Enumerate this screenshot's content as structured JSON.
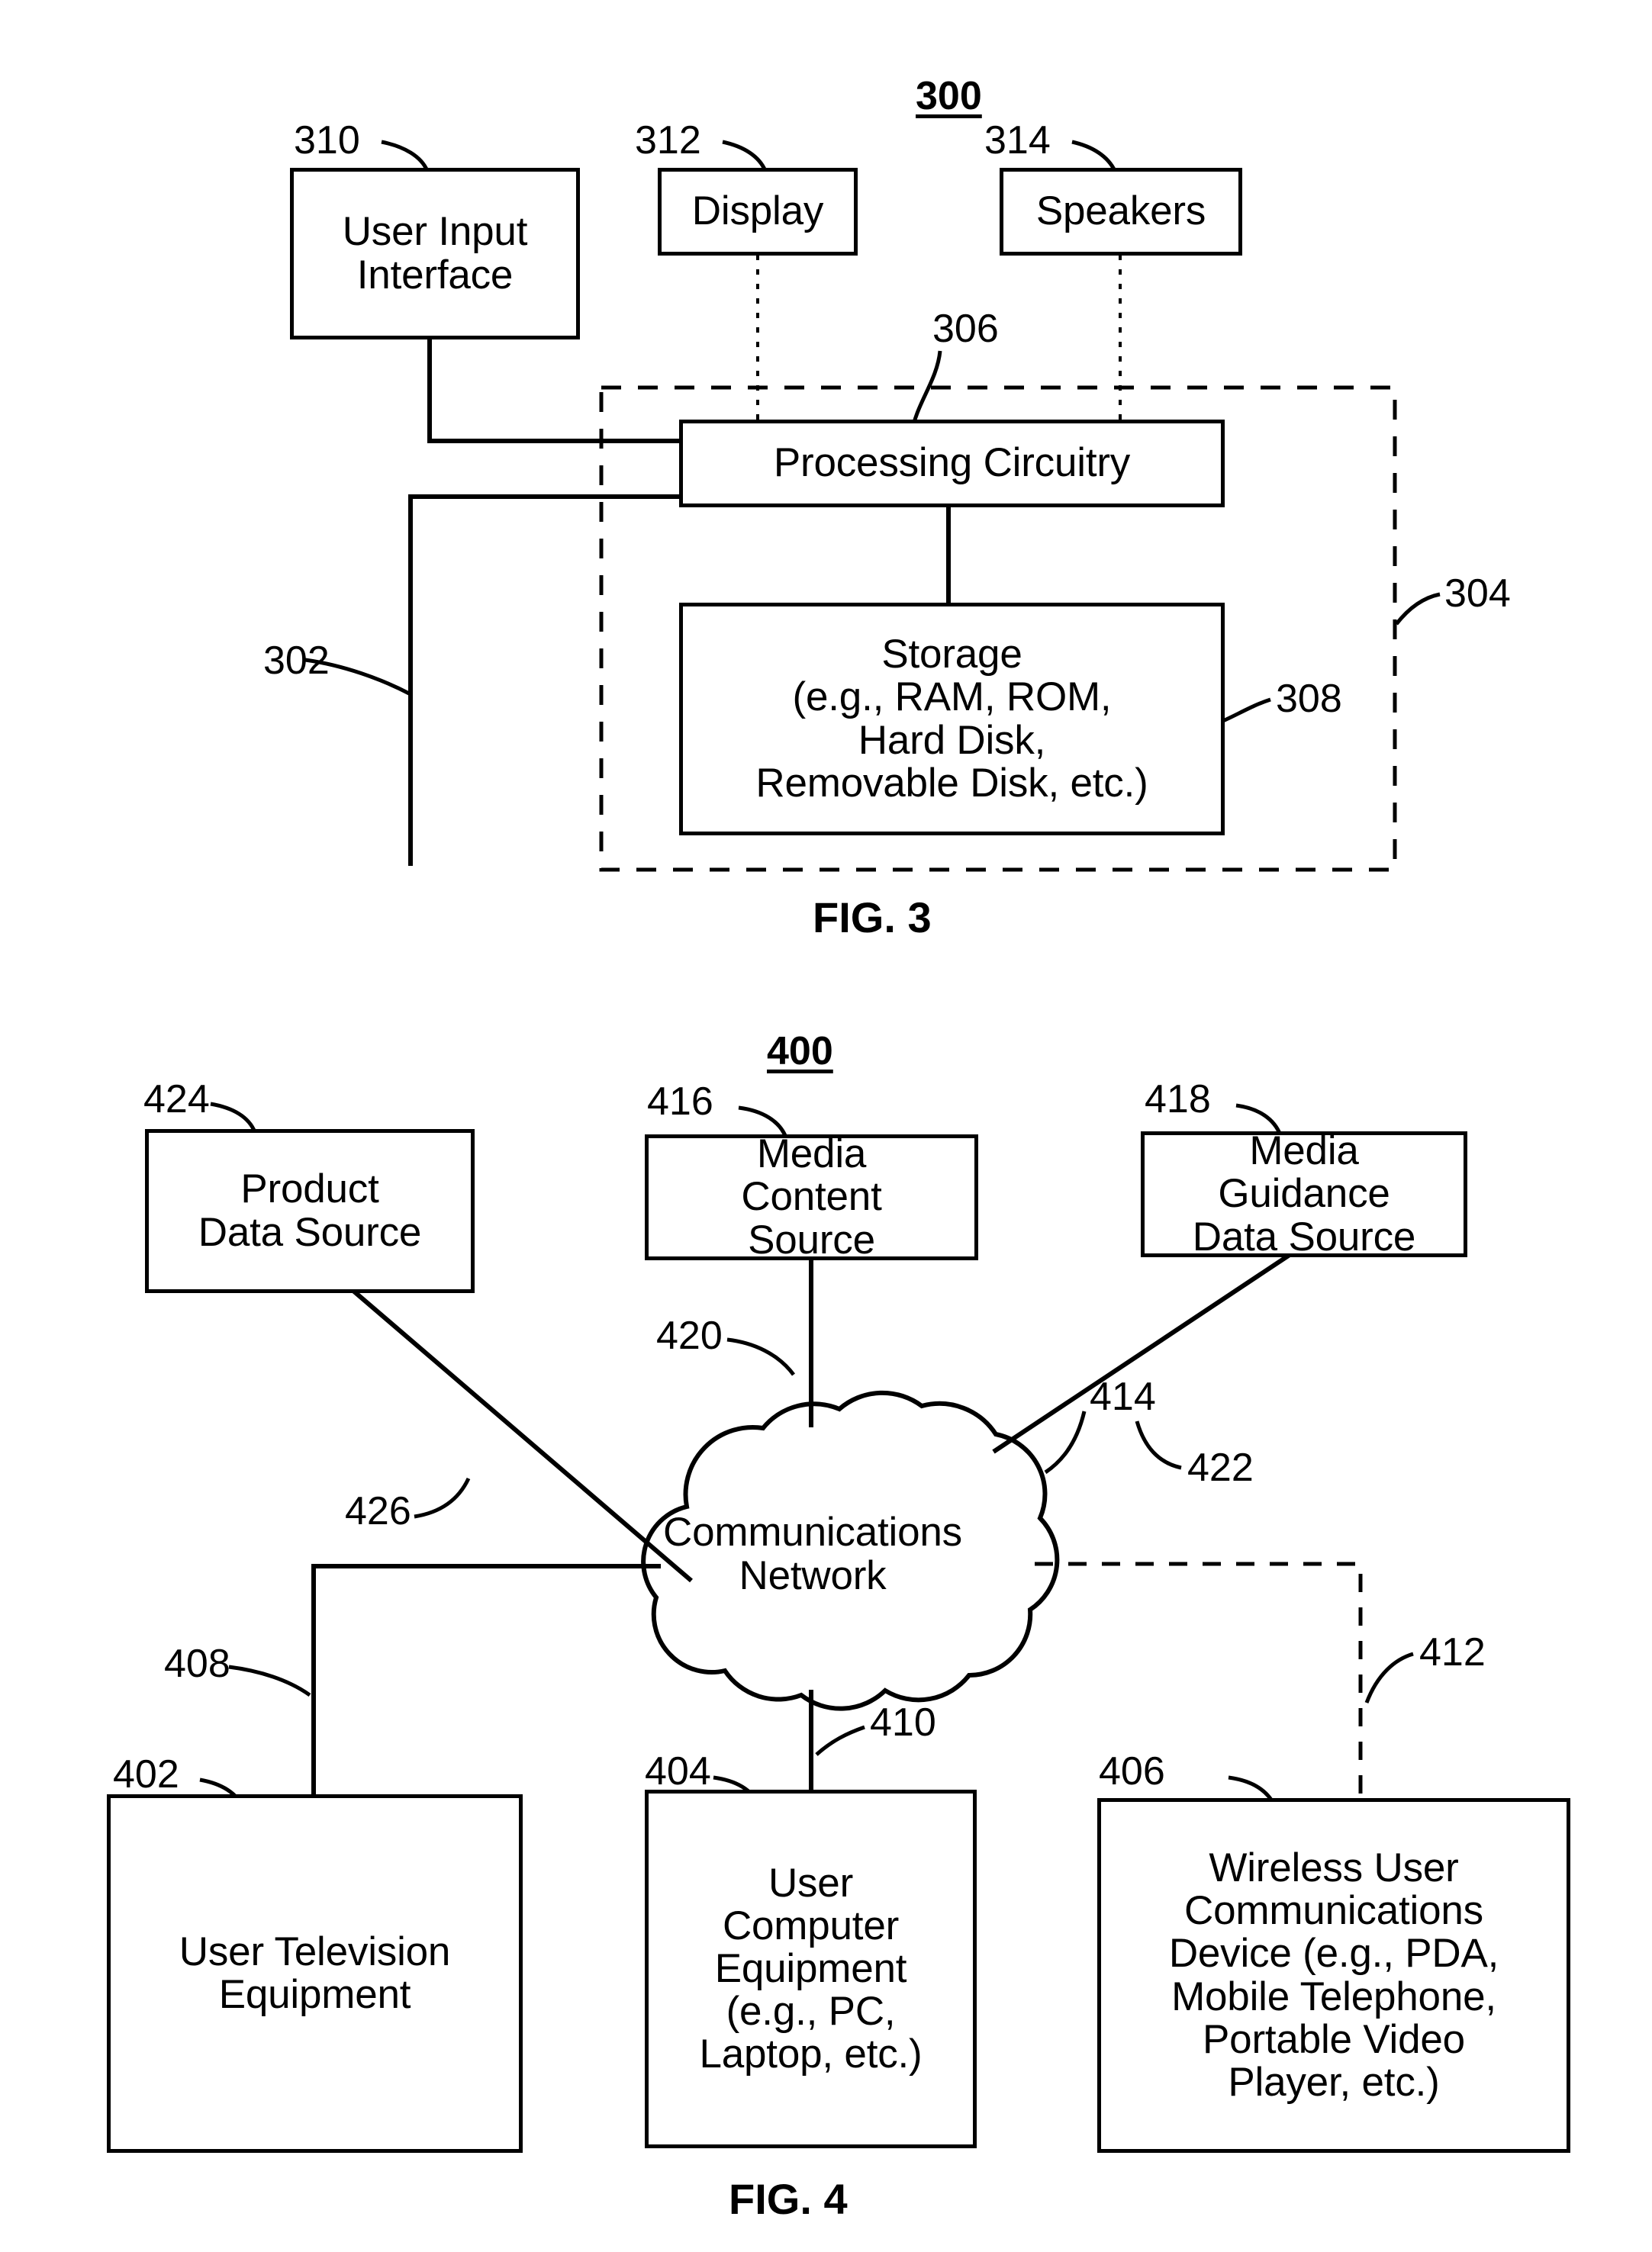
{
  "figures": [
    {
      "id": "fig3",
      "figure_number_label": "300",
      "caption": "FIG. 3",
      "boxes": [
        {
          "key": "user_input_interface",
          "ref": "310",
          "lines": [
            "User Input",
            "Interface"
          ]
        },
        {
          "key": "display",
          "ref": "312",
          "lines": [
            "Display"
          ]
        },
        {
          "key": "speakers",
          "ref": "314",
          "lines": [
            "Speakers"
          ]
        },
        {
          "key": "processing_circuitry",
          "ref": "306",
          "lines": [
            "Processing Circuitry"
          ]
        },
        {
          "key": "storage",
          "ref": "308",
          "lines": [
            "Storage",
            "(e.g., RAM, ROM,",
            "Hard Disk,",
            "Removable Disk, etc.)"
          ]
        }
      ],
      "refs": [
        {
          "key": "control_circuitry_boundary",
          "label": "304"
        },
        {
          "key": "bus_line",
          "label": "302"
        },
        {
          "key": "processing_circuitry_lead",
          "label": "306"
        },
        {
          "key": "storage_lead",
          "label": "308"
        },
        {
          "key": "user_input_interface_lead",
          "label": "310"
        },
        {
          "key": "display_lead",
          "label": "312"
        },
        {
          "key": "speakers_lead",
          "label": "314"
        }
      ]
    },
    {
      "id": "fig4",
      "figure_number_label": "400",
      "caption": "FIG. 4",
      "boxes": [
        {
          "key": "product_data_source",
          "ref": "424",
          "lines": [
            "Product",
            "Data Source"
          ]
        },
        {
          "key": "media_content_source",
          "ref": "416",
          "lines": [
            "Media",
            "Content",
            "Source"
          ]
        },
        {
          "key": "media_guidance_data_source",
          "ref": "418",
          "lines": [
            "Media",
            "Guidance",
            "Data Source"
          ]
        },
        {
          "key": "user_television_equipment",
          "ref": "402",
          "lines": [
            "User Television",
            "Equipment"
          ]
        },
        {
          "key": "user_computer_equipment",
          "ref": "404",
          "lines": [
            "User",
            "Computer",
            "Equipment",
            "(e.g., PC,",
            "Laptop, etc.)"
          ]
        },
        {
          "key": "wireless_user_communications_device",
          "ref": "406",
          "lines": [
            "Wireless User",
            "Communications",
            "Device (e.g., PDA,",
            "Mobile Telephone,",
            "Portable Video",
            "Player, etc.)"
          ]
        }
      ],
      "cloud": {
        "key": "communications_network",
        "lines": [
          "Communications",
          "Network"
        ]
      },
      "refs": [
        {
          "key": "product_data_source_link",
          "label": "426"
        },
        {
          "key": "media_content_source_link",
          "label": "420"
        },
        {
          "key": "media_guidance_data_source_link",
          "label": "422"
        },
        {
          "key": "user_television_equipment_link",
          "label": "408"
        },
        {
          "key": "user_computer_equipment_link",
          "label": "410"
        },
        {
          "key": "wireless_device_link",
          "label": "412"
        },
        {
          "key": "network_lead",
          "label": "414"
        },
        {
          "key": "product_data_source_lead",
          "label": "424"
        },
        {
          "key": "media_content_source_lead",
          "label": "416"
        },
        {
          "key": "media_guidance_data_source_lead",
          "label": "418"
        },
        {
          "key": "user_television_equipment_lead",
          "label": "402"
        },
        {
          "key": "user_computer_equipment_lead",
          "label": "404"
        },
        {
          "key": "wireless_device_lead",
          "label": "406"
        }
      ]
    }
  ],
  "colors": {
    "ink": "#000000",
    "paper": "#ffffff"
  }
}
